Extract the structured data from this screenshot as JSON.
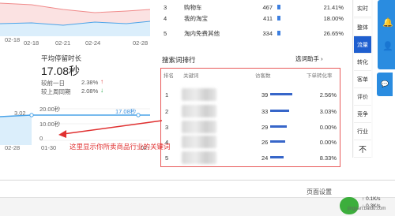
{
  "top_chart": {
    "x_ticks": [
      "02-18",
      "02-21",
      "02-24",
      "02-28"
    ],
    "colors": {
      "red_line": "#f08a8a",
      "blue_line": "#4aa3e8",
      "red_fill": "#fbe2e2",
      "blue_fill": "#dbeefb"
    }
  },
  "top_rank_rows": [
    {
      "rank": "3",
      "name": "购物车",
      "count": "467",
      "percent": "21.41%"
    },
    {
      "rank": "4",
      "name": "我的淘宝",
      "count": "411",
      "percent": "18.00%"
    },
    {
      "rank": "5",
      "name": "淘内免费其他",
      "count": "334",
      "percent": "26.65%"
    }
  ],
  "stay_time": {
    "title": "平均停留时长",
    "value": "17.08秒",
    "compare": [
      {
        "label": "较前一日",
        "value": "2.38%",
        "dir": "up",
        "color": "#e04040"
      },
      {
        "label": "较上周同期",
        "value": "2.08%",
        "dir": "down",
        "color": "#2aa84a"
      }
    ]
  },
  "mid_chart": {
    "y_ticks": [
      "20.00秒",
      "10.00秒",
      "0"
    ],
    "point_labels": [
      "3.02",
      "17.08秒"
    ],
    "x_ticks": [
      "02-28",
      "01-30",
      "02-"
    ],
    "colors": {
      "line": "#4aa3e8",
      "fill": "#dbeefb"
    }
  },
  "search_rank": {
    "title": "搜索词排行",
    "assistant_link": "选词助手",
    "headers": {
      "rank": "排名",
      "keyword": "关键词",
      "count": "访客数",
      "rate": "下单转化率"
    },
    "rows": [
      {
        "rank": "1",
        "count": "39",
        "bar": 1.0,
        "rate": "2.56%"
      },
      {
        "rank": "2",
        "count": "33",
        "bar": 0.85,
        "rate": "3.03%"
      },
      {
        "rank": "3",
        "count": "29",
        "bar": 0.74,
        "rate": "0.00%"
      },
      {
        "rank": "4",
        "count": "26",
        "bar": 0.67,
        "rate": "0.00%"
      },
      {
        "rank": "5",
        "count": "24",
        "bar": 0.62,
        "rate": "8.33%"
      }
    ]
  },
  "annotation": "这里显示你所卖商品行业的关键词",
  "side_nav": [
    "实时",
    "整体",
    "流量",
    "转化",
    "客单",
    "评价",
    "竞争",
    "行业"
  ],
  "side_nav_active": "流量",
  "side_expand": "不",
  "status": {
    "bottom_text": "页面设置",
    "speed_up": "0.1K/s",
    "speed_down": "0.3K/s",
    "watermark": "jingyan.baidu.com"
  }
}
